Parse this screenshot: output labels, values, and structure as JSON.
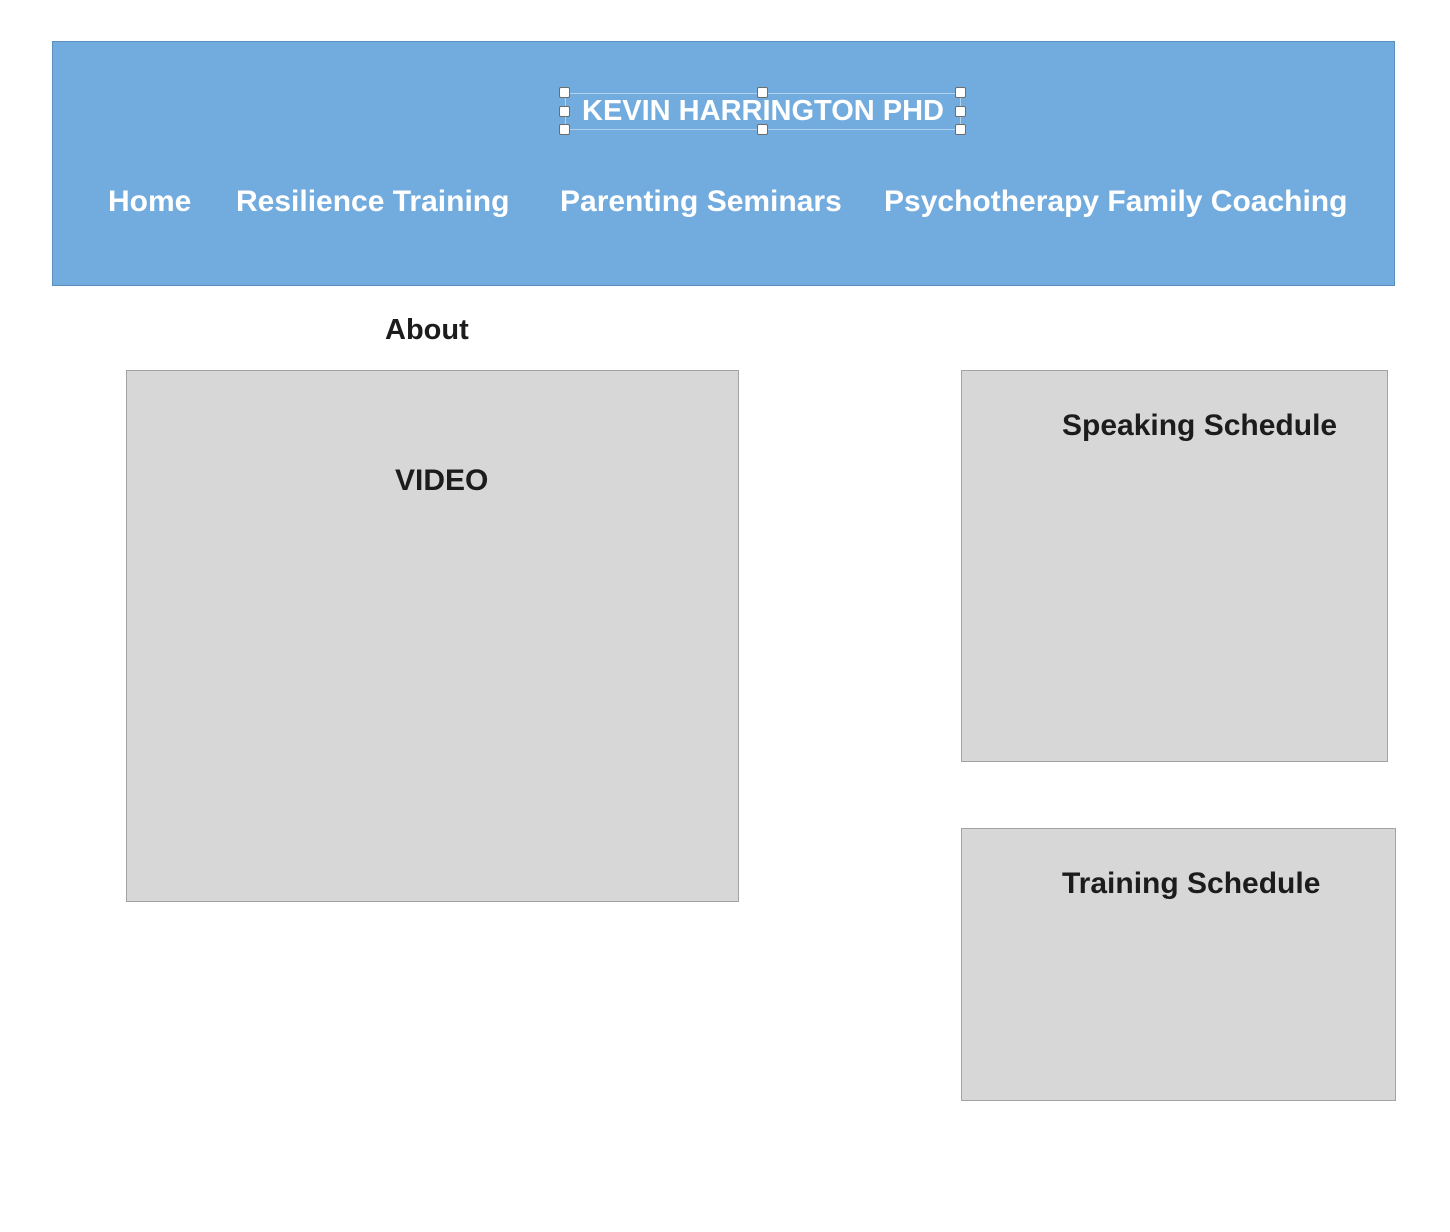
{
  "header": {
    "title": "KEVIN HARRINGTON PHD",
    "nav": [
      {
        "label": "Home"
      },
      {
        "label": "Resilience Training"
      },
      {
        "label": "Parenting Seminars"
      },
      {
        "label": "Psychotherapy Family Coaching"
      }
    ],
    "background_color": "#72abdd"
  },
  "main": {
    "about_heading": "About",
    "video_box": {
      "label": "VIDEO"
    },
    "speaking_box": {
      "label": "Speaking Schedule"
    },
    "training_box": {
      "label": "Training Schedule"
    },
    "placeholder_color": "#d7d7d7"
  }
}
